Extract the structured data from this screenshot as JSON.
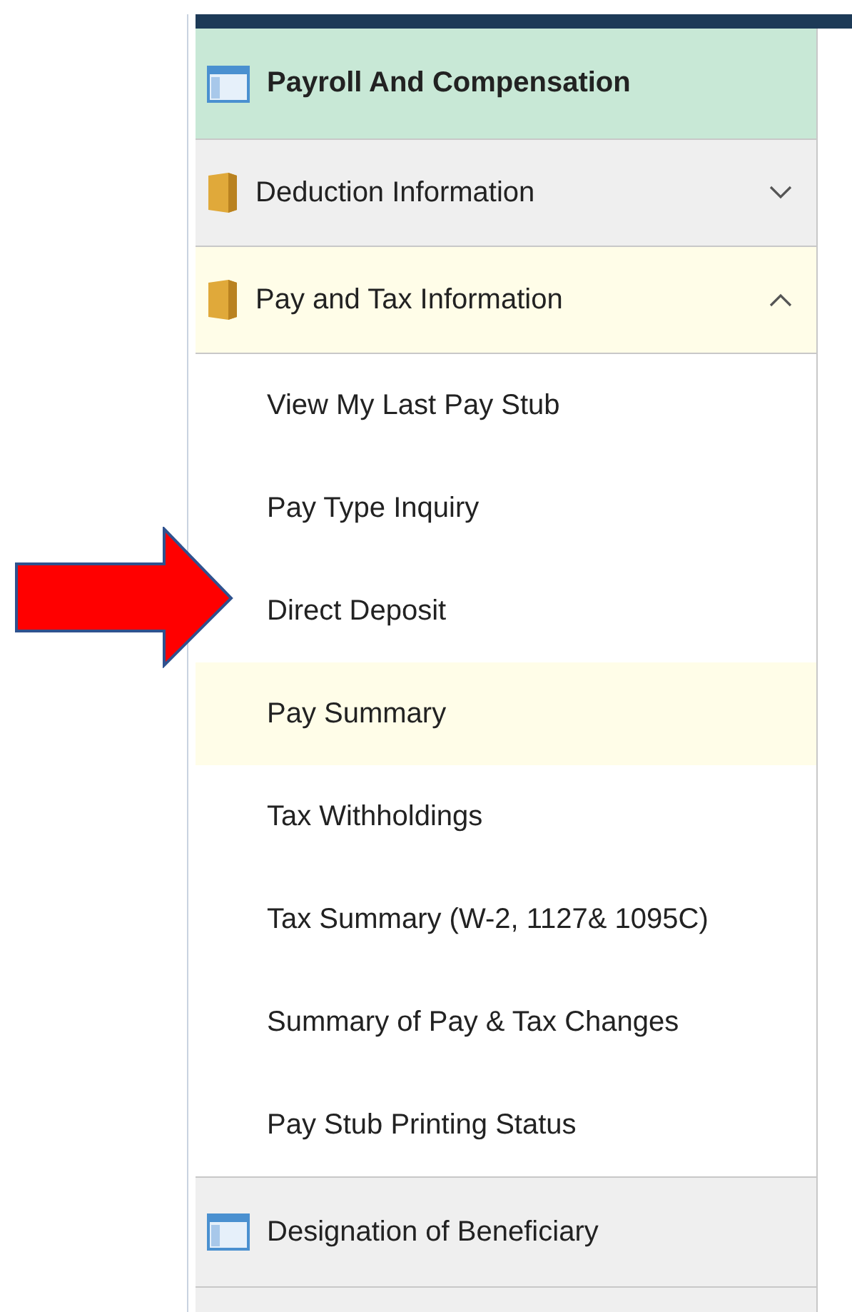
{
  "sections": [
    {
      "kind": "header",
      "label": "Payroll And Compensation"
    },
    {
      "kind": "group",
      "label": "Deduction Information",
      "expanded": false
    },
    {
      "kind": "group",
      "label": "Pay and Tax Information",
      "expanded": true,
      "items": [
        {
          "label": "View My Last Pay Stub",
          "selected": false
        },
        {
          "label": "Pay Type Inquiry",
          "selected": false
        },
        {
          "label": "Direct Deposit",
          "selected": false
        },
        {
          "label": "Pay Summary",
          "selected": true
        },
        {
          "label": "Tax Withholdings",
          "selected": false
        },
        {
          "label": "Tax Summary (W-2, 1127& 1095C)",
          "selected": false
        },
        {
          "label": "Summary of Pay & Tax Changes",
          "selected": false
        },
        {
          "label": "Pay Stub Printing Status",
          "selected": false
        }
      ]
    },
    {
      "kind": "page",
      "label": "Designation of Beneficiary"
    }
  ],
  "pointer": {
    "kind": "arrow"
  }
}
